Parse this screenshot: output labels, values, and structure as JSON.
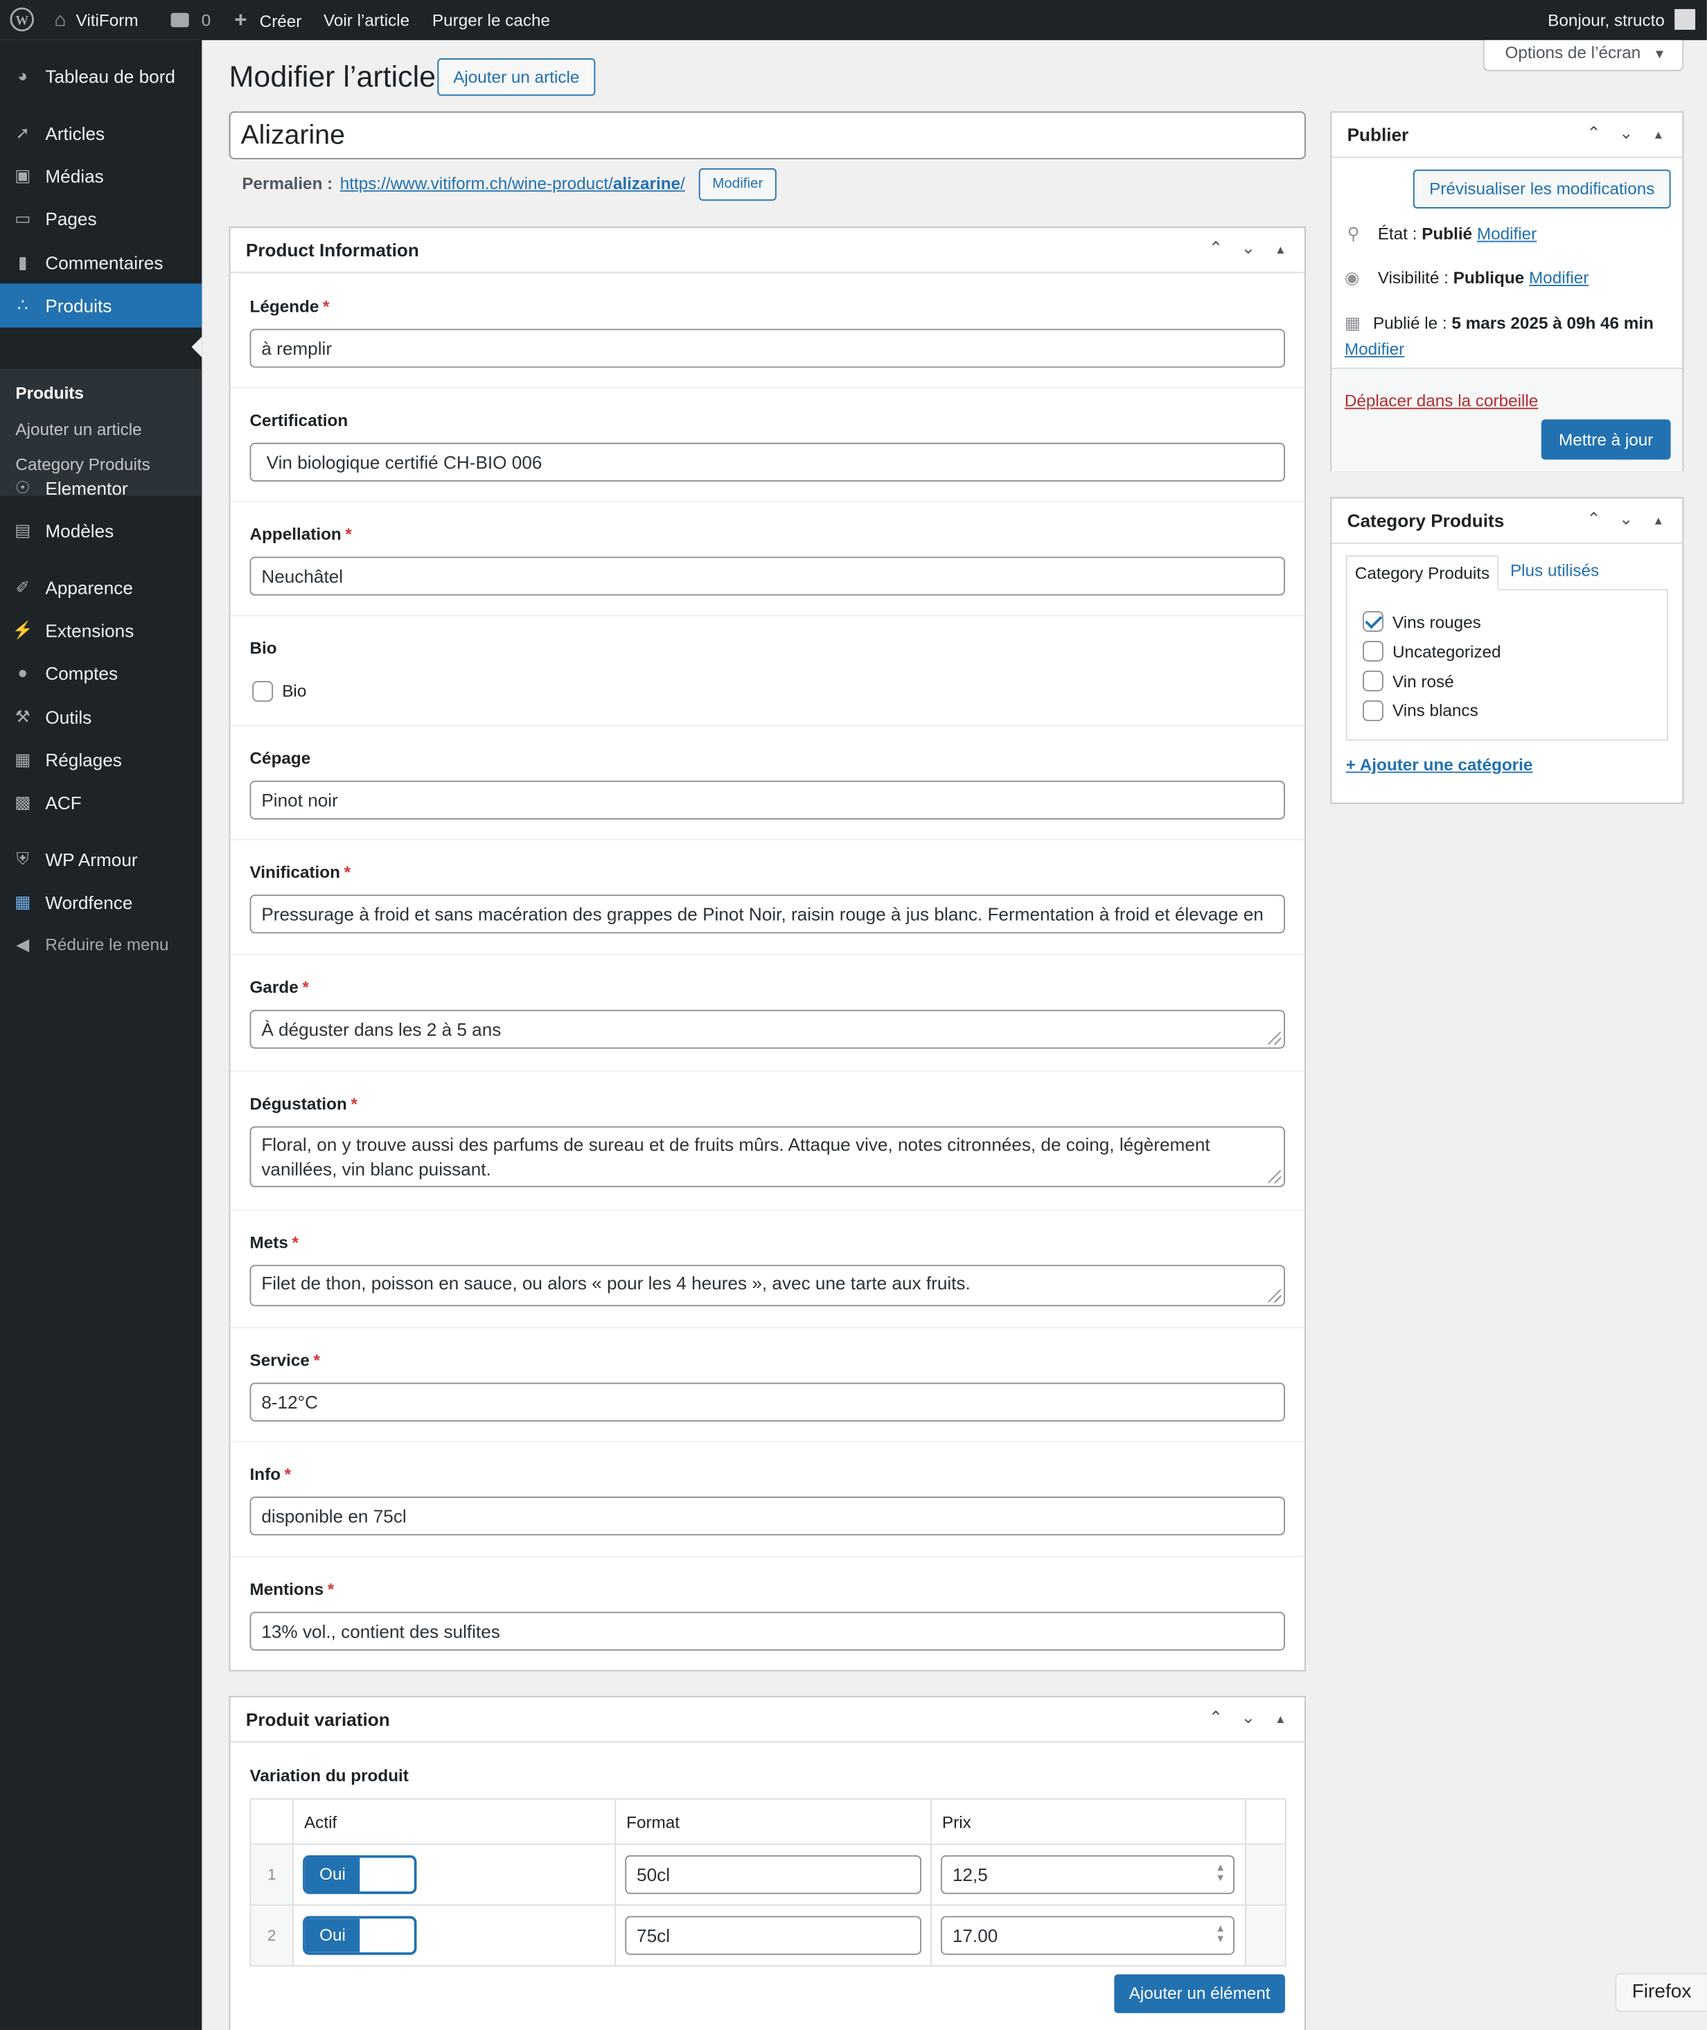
{
  "admin_bar": {
    "site_name": "VitiForm",
    "comments_count": "0",
    "create_label": "Créer",
    "view_article": "Voir l’article",
    "purge_cache": "Purger le cache",
    "greeting": "Bonjour, structo"
  },
  "menu": {
    "items": [
      {
        "label": "Tableau de bord",
        "icon": "dashboard-icon"
      },
      {
        "label": "Articles",
        "icon": "pin-icon"
      },
      {
        "label": "Médias",
        "icon": "media-icon"
      },
      {
        "label": "Pages",
        "icon": "pages-icon"
      },
      {
        "label": "Commentaires",
        "icon": "comments-icon"
      },
      {
        "label": "Produits",
        "icon": "products-icon"
      },
      {
        "label": "Elementor",
        "icon": "elementor-icon"
      },
      {
        "label": "Modèles",
        "icon": "folder-icon"
      },
      {
        "label": "Apparence",
        "icon": "brush-icon"
      },
      {
        "label": "Extensions",
        "icon": "plugin-icon"
      },
      {
        "label": "Comptes",
        "icon": "user-icon"
      },
      {
        "label": "Outils",
        "icon": "wrench-icon"
      },
      {
        "label": "Réglages",
        "icon": "settings-icon"
      },
      {
        "label": "ACF",
        "icon": "acf-icon"
      },
      {
        "label": "WP Armour",
        "icon": "shield-icon"
      },
      {
        "label": "Wordfence",
        "icon": "wordfence-icon"
      },
      {
        "label": "Réduire le menu",
        "icon": "collapse-icon"
      }
    ],
    "submenu": [
      "Produits",
      "Ajouter un article",
      "Category Produits"
    ]
  },
  "header": {
    "title": "Modifier l’article",
    "add_button": "Ajouter un article",
    "screen_options": "Options de l’écran"
  },
  "post": {
    "title": "Alizarine",
    "permalink_label": "Permalien :",
    "permalink_base": "https://www.vitiform.ch/wine-product/",
    "permalink_slug": "alizarine",
    "permalink_end": "/",
    "permalink_edit": "Modifier"
  },
  "product_info": {
    "title": "Product Information",
    "fields": {
      "legende": {
        "label": "Légende",
        "value": "à remplir"
      },
      "certification": {
        "label": "Certification",
        "value": " Vin biologique certifié CH-BIO 006"
      },
      "appellation": {
        "label": "Appellation",
        "value": "Neuchâtel"
      },
      "bio": {
        "label": "Bio",
        "checkbox_label": "Bio"
      },
      "cepage": {
        "label": "Cépage",
        "value": "Pinot noir"
      },
      "vinification": {
        "label": "Vinification",
        "value": "Pressurage à froid et sans macération des grappes de Pinot Noir, raisin rouge à jus blanc. Fermentation à froid et élevage en"
      },
      "garde": {
        "label": "Garde",
        "value": "À déguster dans les 2 à 5 ans"
      },
      "degustation": {
        "label": "Dégustation",
        "value": "Floral, on y trouve aussi des parfums de sureau et de fruits mûrs. Attaque vive, notes citronnées, de coing, légèrement vanillées, vin blanc puissant."
      },
      "mets": {
        "label": "Mets",
        "value": "Filet de thon, poisson en sauce, ou alors « pour les 4 heures », avec une tarte aux fruits."
      },
      "service": {
        "label": "Service",
        "value": "8-12°C"
      },
      "info": {
        "label": "Info",
        "value": "disponible en 75cl"
      },
      "mentions": {
        "label": "Mentions",
        "value": "13% vol., contient des sulfites"
      }
    }
  },
  "variation": {
    "title": "Produit variation",
    "field_label": "Variation du produit",
    "columns": [
      "Actif",
      "Format",
      "Prix"
    ],
    "rows": [
      {
        "index": "1",
        "active": "Oui",
        "format": "50cl",
        "price": "12,5"
      },
      {
        "index": "2",
        "active": "Oui",
        "format": "75cl",
        "price": "17.00"
      }
    ],
    "add_button": "Ajouter un élément"
  },
  "publish": {
    "title": "Publier",
    "preview": "Prévisualiser les modifications",
    "status_label": "État :",
    "status_value": "Publié",
    "visibility_label": "Visibilité :",
    "visibility_value": "Publique",
    "published_label": "Publié le :",
    "published_value": "5 mars 2025 à 09h 46 min",
    "edit": "Modifier",
    "trash": "Déplacer dans la corbeille",
    "update": "Mettre à jour"
  },
  "categories": {
    "title": "Category Produits",
    "tab_all": "Category Produits",
    "tab_popular": "Plus utilisés",
    "items": [
      {
        "label": "Vins rouges",
        "checked": true
      },
      {
        "label": "Uncategorized",
        "checked": false
      },
      {
        "label": "Vin rosé",
        "checked": false
      },
      {
        "label": "Vins blancs",
        "checked": false
      }
    ],
    "add": "+ Ajouter une catégorie"
  },
  "browser_tooltip": "Firefox"
}
